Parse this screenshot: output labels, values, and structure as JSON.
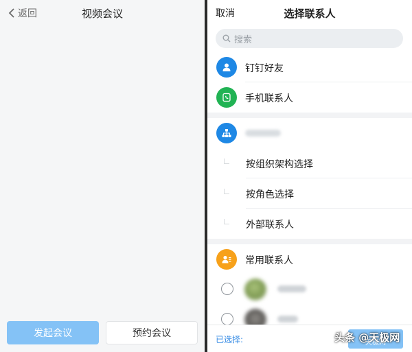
{
  "left": {
    "back_label": "返回",
    "title": "视频会议",
    "start_button": "发起会议",
    "schedule_button": "预约会议"
  },
  "right": {
    "cancel_label": "取消",
    "title": "选择联系人",
    "search_placeholder": "搜索",
    "rows": {
      "dingtalk_friends": "钉钉好友",
      "phone_contacts": "手机联系人",
      "frequent_contacts": "常用联系人"
    },
    "org_options": [
      "按组织架构选择",
      "按角色选择",
      "外部联系人"
    ],
    "selected_label": "已选择:",
    "confirm_label": "天极网"
  },
  "watermark": "头条 @天极网",
  "colors": {
    "primary_blue": "#1e88e5",
    "phone_green": "#21b354",
    "frequent_orange": "#f7a11a",
    "disabled_button": "#84c2f6"
  },
  "icons": {
    "back": "chevron-left-icon",
    "search": "search-icon",
    "friends": "person-icon",
    "phone": "phone-icon",
    "org": "org-chart-icon",
    "frequent": "person-list-icon"
  }
}
